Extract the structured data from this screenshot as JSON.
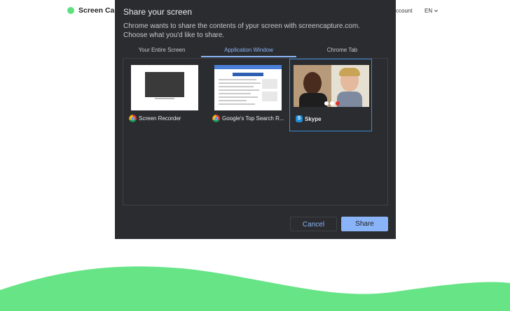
{
  "page": {
    "brand": "Screen Capt",
    "nav_account": "ccount",
    "lang": "EN"
  },
  "dialog": {
    "title": "Share your screen",
    "description": "Chrome wants to share the contents of ypur screen with screencapture.com. Choose what you'd like to share.",
    "tabs": [
      {
        "label": "Your Entire Screen",
        "active": false
      },
      {
        "label": "Application Window",
        "active": true
      },
      {
        "label": "Chrome Tab",
        "active": false
      }
    ],
    "windows": [
      {
        "label": "Screen Recorder",
        "icon": "chrome-icon",
        "selected": false
      },
      {
        "label": "Google's Top Search R...",
        "icon": "chrome-icon",
        "selected": false
      },
      {
        "label": "Skype",
        "icon": "skype-icon",
        "selected": true
      }
    ],
    "cancel_label": "Cancel",
    "share_label": "Share"
  },
  "colors": {
    "accent": "#8ab4f8",
    "dialog_bg": "#2b2c2f",
    "brand_green": "#5ee07e"
  }
}
